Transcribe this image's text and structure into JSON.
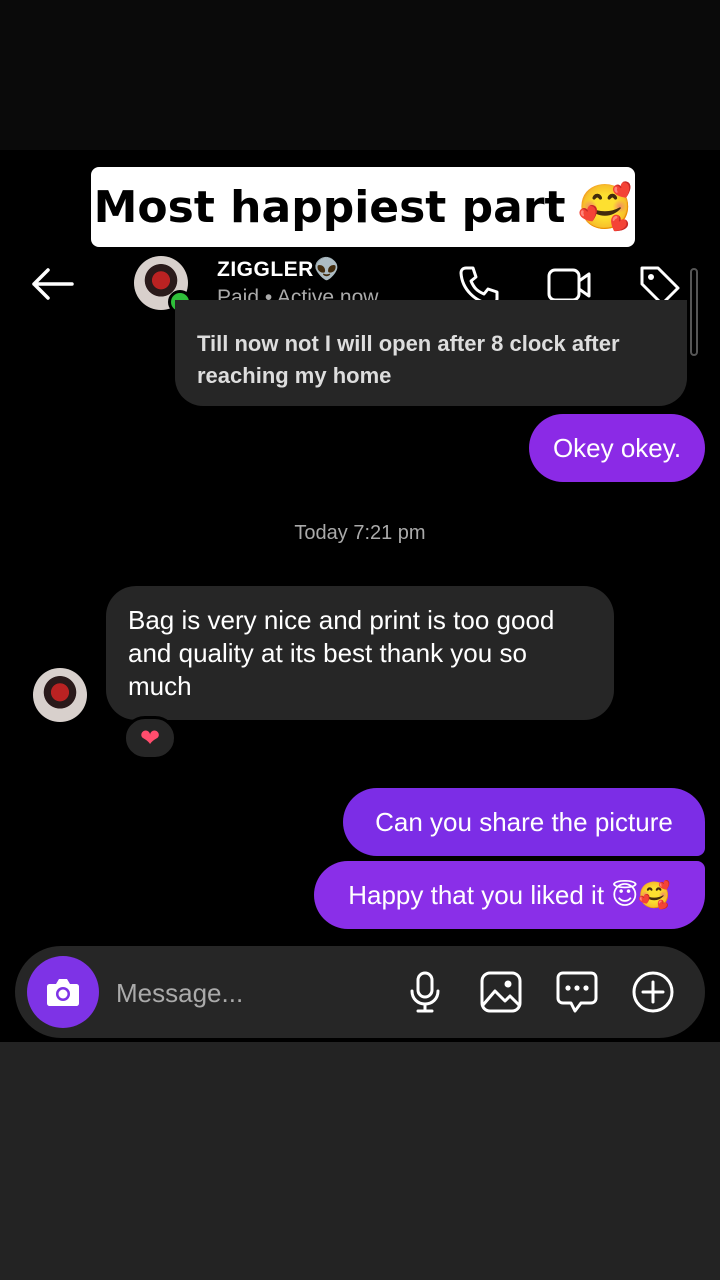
{
  "caption": {
    "text": "Most happiest part",
    "emoji": "🥰"
  },
  "header": {
    "contact_name": "ZIGGLER👽",
    "status": "Paid • Active now",
    "icons": [
      "back-arrow-icon",
      "phone-icon",
      "video-camera-icon",
      "tag-icon"
    ]
  },
  "messages": [
    {
      "direction": "in",
      "text": "Till now not I will open after 8 clock after reaching my home"
    },
    {
      "direction": "out",
      "text": "Okey okey."
    },
    {
      "direction": "in",
      "text": "Bag is very nice and print is too good and quality at its best thank you so much",
      "reaction": "❤"
    },
    {
      "direction": "out",
      "text": "Can you share the picture"
    },
    {
      "direction": "out",
      "text": "Happy that you liked it 😇🥰"
    }
  ],
  "timestamp": "Today 7:21 pm",
  "composer": {
    "placeholder": "Message...",
    "icons": [
      "camera-icon",
      "microphone-icon",
      "gallery-icon",
      "chat-bubble-icon",
      "add-icon"
    ]
  },
  "colors": {
    "outgoing_bubble": "#8b2ae6",
    "incoming_bubble": "#262626",
    "online": "#2fbf3a"
  }
}
